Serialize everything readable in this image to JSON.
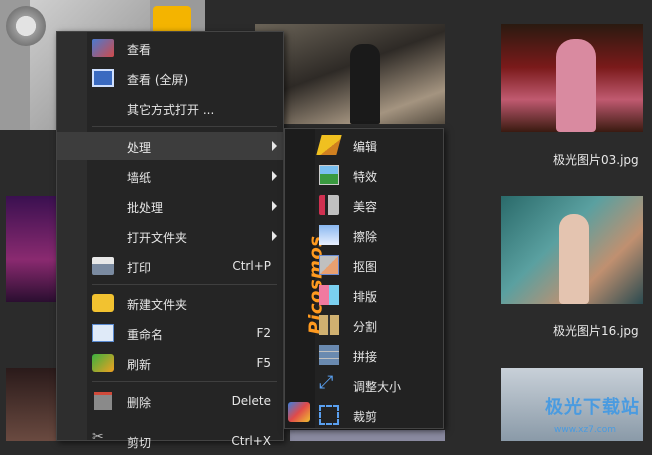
{
  "menu": {
    "items": [
      {
        "label": "查看"
      },
      {
        "label": "查看 (全屏)"
      },
      {
        "label": "其它方式打开 ..."
      },
      {
        "label": "处理"
      },
      {
        "label": "墙纸"
      },
      {
        "label": "批处理"
      },
      {
        "label": "打开文件夹"
      },
      {
        "label": "打印",
        "shortcut": "Ctrl+P"
      },
      {
        "label": "新建文件夹"
      },
      {
        "label": "重命名",
        "shortcut": "F2"
      },
      {
        "label": "刷新",
        "shortcut": "F5"
      },
      {
        "label": "删除",
        "shortcut": "Delete"
      },
      {
        "label": "剪切",
        "shortcut": "Ctrl+X"
      }
    ]
  },
  "submenu": {
    "brand": "Picosmos",
    "items": [
      {
        "label": "编辑"
      },
      {
        "label": "特效"
      },
      {
        "label": "美容"
      },
      {
        "label": "擦除"
      },
      {
        "label": "抠图"
      },
      {
        "label": "排版"
      },
      {
        "label": "分割"
      },
      {
        "label": "拼接"
      },
      {
        "label": "调整大小"
      },
      {
        "label": "裁剪"
      }
    ]
  },
  "gallery": {
    "captions": [
      "极光图片03.jpg",
      "极光图片16.jpg"
    ]
  },
  "watermark": {
    "text": "极光下载站",
    "sub": "www.xz7.com"
  },
  "colors": {
    "accent": "#ff9a1f",
    "menu_bg": "#252525",
    "page_bg": "#2b2b2b"
  }
}
